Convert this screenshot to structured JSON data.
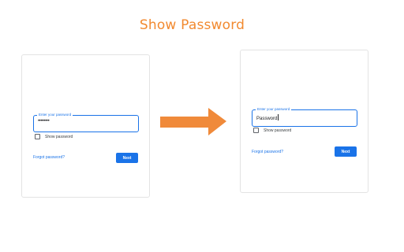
{
  "header": {
    "title": "Show Password"
  },
  "login_before": {
    "field_label": "Enter your password",
    "field_value": "••••••••",
    "checkbox_label": "Show password",
    "forgot_link": "Forgot password?",
    "next_button": "Next"
  },
  "login_after": {
    "field_label": "Enter your password",
    "field_value": "Password",
    "checkbox_label": "Show password",
    "forgot_link": "Forgot password?",
    "next_button": "Next"
  },
  "colors": {
    "title": "#f28a30",
    "arrow": "#f08a3a",
    "accent": "#1a73e8"
  },
  "icons": {
    "transition": "right-arrow-icon"
  }
}
